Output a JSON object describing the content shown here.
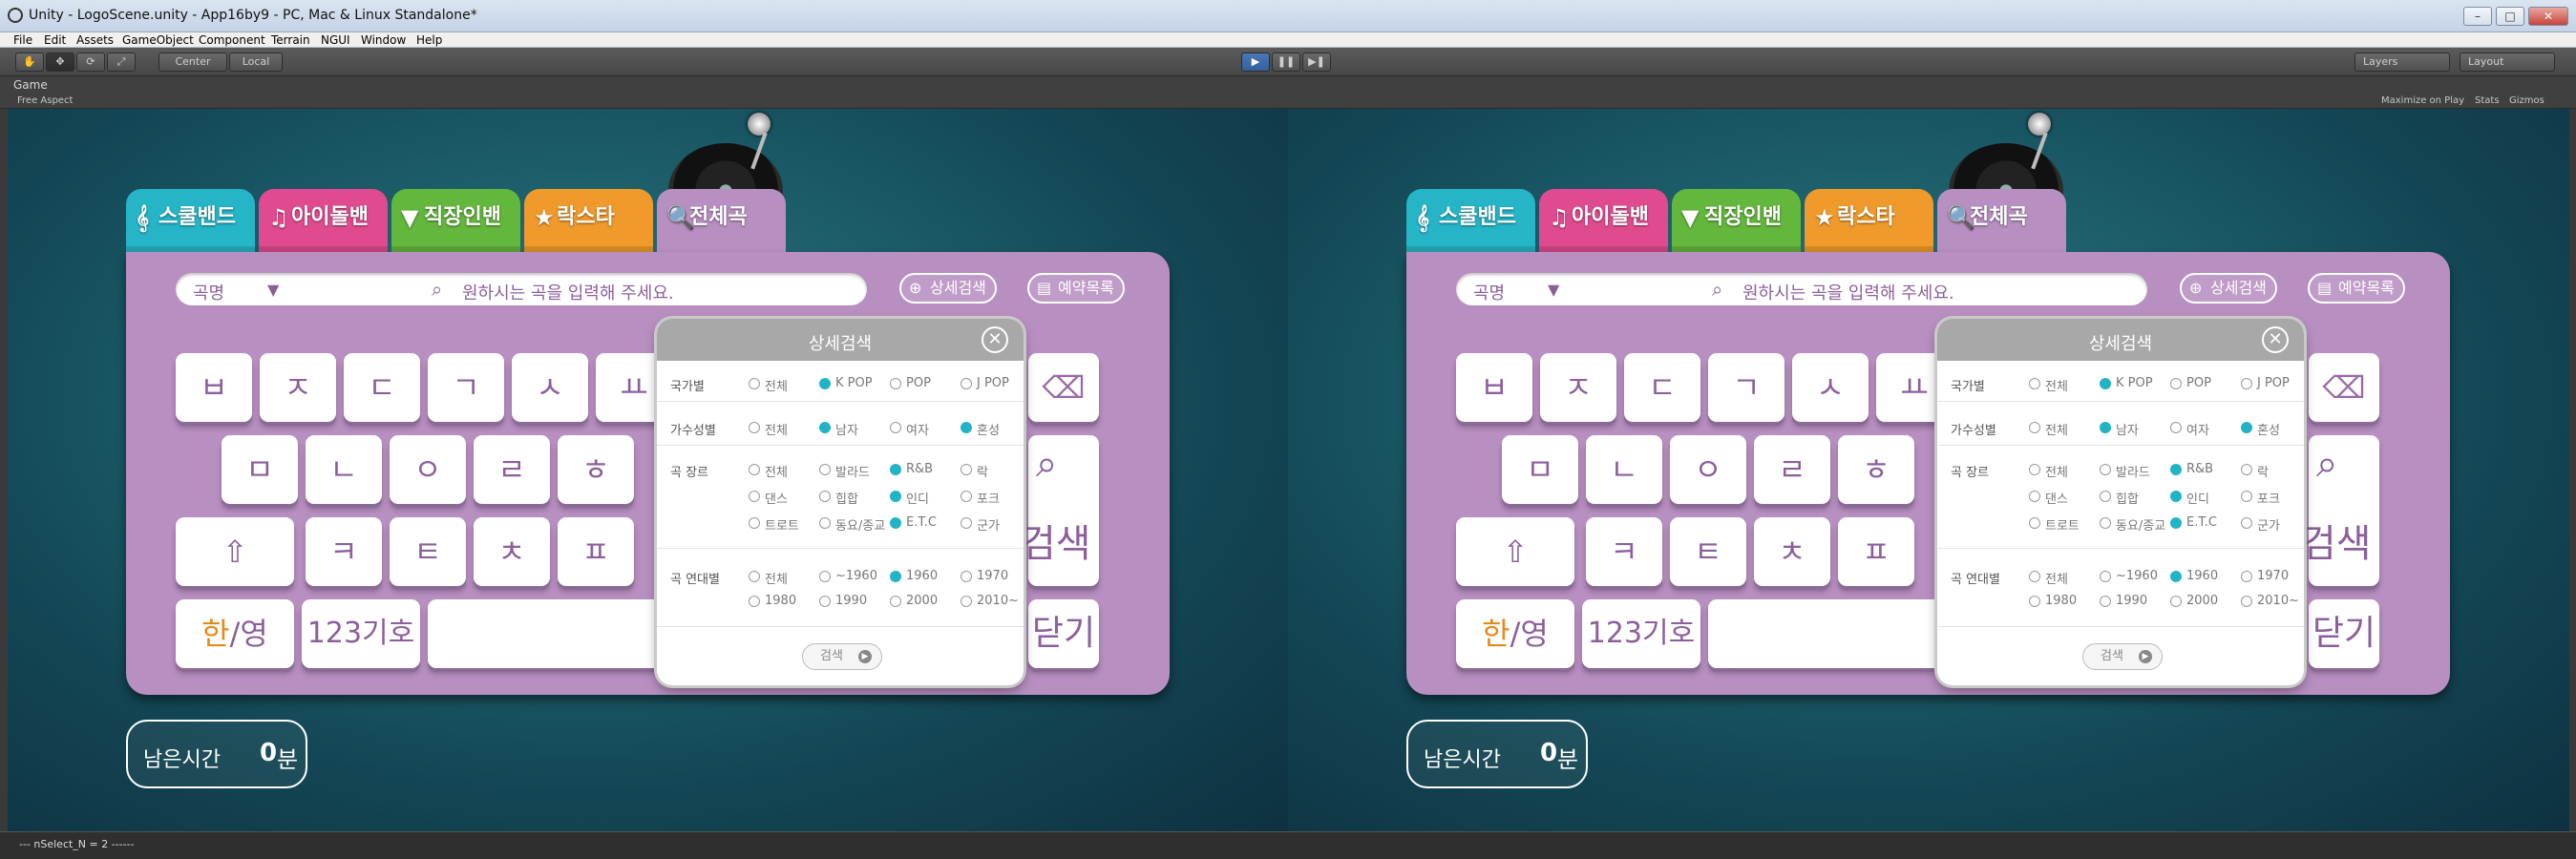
{
  "window": {
    "title": "Unity - LogoScene.unity - App16by9 - PC, Mac & Linux Standalone*",
    "minimize": "–",
    "maximize": "□",
    "close": "✕"
  },
  "menu": [
    "File",
    "Edit",
    "Assets",
    "GameObject",
    "Component",
    "Terrain",
    "NGUI",
    "Window",
    "Help"
  ],
  "toolbar": {
    "center": "Center",
    "local": "Local",
    "layers": "Layers",
    "layout": "Layout"
  },
  "game": {
    "tab": "Game",
    "aspect": "Free Aspect",
    "maximize": "Maximize on Play",
    "stats": "Stats",
    "gizmos": "Gizmos"
  },
  "tabs": [
    {
      "label": "스쿨밴드",
      "icon": "treble-clef-icon",
      "glyph": "𝄞",
      "color": "#25b5c7"
    },
    {
      "label": "아이돌밴드",
      "icon": "music-note-icon",
      "glyph": "♫",
      "color": "#e04b8f"
    },
    {
      "label": "직장인밴드",
      "icon": "necktie-icon",
      "glyph": "▼",
      "color": "#63b73c"
    },
    {
      "label": "락스타",
      "icon": "star-icon",
      "glyph": "★",
      "color": "#f09a2b"
    },
    {
      "label": "전체곡",
      "icon": "magnifier-icon",
      "glyph": "🔍",
      "color": "#b88fc1"
    }
  ],
  "search": {
    "category": "곡명",
    "placeholder": "원하시는 곡을 입력해 주세요.",
    "detail_label": "상세검색",
    "reserve_label": "예약목록"
  },
  "keys": {
    "row1": [
      "ㅂ",
      "ㅈ",
      "ㄷ",
      "ㄱ",
      "ㅅ",
      "ㅛ"
    ],
    "row2": [
      "ㅁ",
      "ㄴ",
      "ㅇ",
      "ㄹ",
      "ㅎ"
    ],
    "row3": [
      "ㅋ",
      "ㅌ",
      "ㅊ",
      "ㅍ"
    ],
    "shift": "⇧",
    "lang_han": "한",
    "lang_rest": "/영",
    "num": "123기호",
    "search_big": "검색",
    "close_big": "닫기"
  },
  "timer": {
    "label": "남은시간",
    "value": "0",
    "unit": "분"
  },
  "popup": {
    "title": "상세검색",
    "rows": [
      {
        "label": "국가별",
        "options": [
          {
            "t": "전체",
            "on": false
          },
          {
            "t": "K POP",
            "on": true
          },
          {
            "t": "POP",
            "on": false
          },
          {
            "t": "J POP",
            "on": false
          }
        ]
      },
      {
        "label": "가수성별",
        "options": [
          {
            "t": "전체",
            "on": false
          },
          {
            "t": "남자",
            "on": true
          },
          {
            "t": "여자",
            "on": false
          },
          {
            "t": "혼성",
            "on": true
          }
        ]
      },
      {
        "label": "곡 장르",
        "options": [
          {
            "t": "전체",
            "on": false
          },
          {
            "t": "발라드",
            "on": false
          },
          {
            "t": "R&B",
            "on": true
          },
          {
            "t": "락",
            "on": false
          },
          {
            "t": "댄스",
            "on": false
          },
          {
            "t": "힙합",
            "on": false
          },
          {
            "t": "인디",
            "on": true
          },
          {
            "t": "포크",
            "on": false
          },
          {
            "t": "트로트",
            "on": false
          },
          {
            "t": "동요/종교",
            "on": false
          },
          {
            "t": "E.T.C",
            "on": true
          },
          {
            "t": "군가",
            "on": false
          }
        ]
      },
      {
        "label": "곡 연대별",
        "options": [
          {
            "t": "전체",
            "on": false
          },
          {
            "t": "~1960",
            "on": false
          },
          {
            "t": "1960",
            "on": true
          },
          {
            "t": "1970",
            "on": false
          },
          {
            "t": "1980",
            "on": false
          },
          {
            "t": "1990",
            "on": false
          },
          {
            "t": "2000",
            "on": false
          },
          {
            "t": "2010~",
            "on": false
          }
        ]
      }
    ],
    "search_btn": "검색"
  },
  "status": "--- nSelect_N = 2 ------"
}
